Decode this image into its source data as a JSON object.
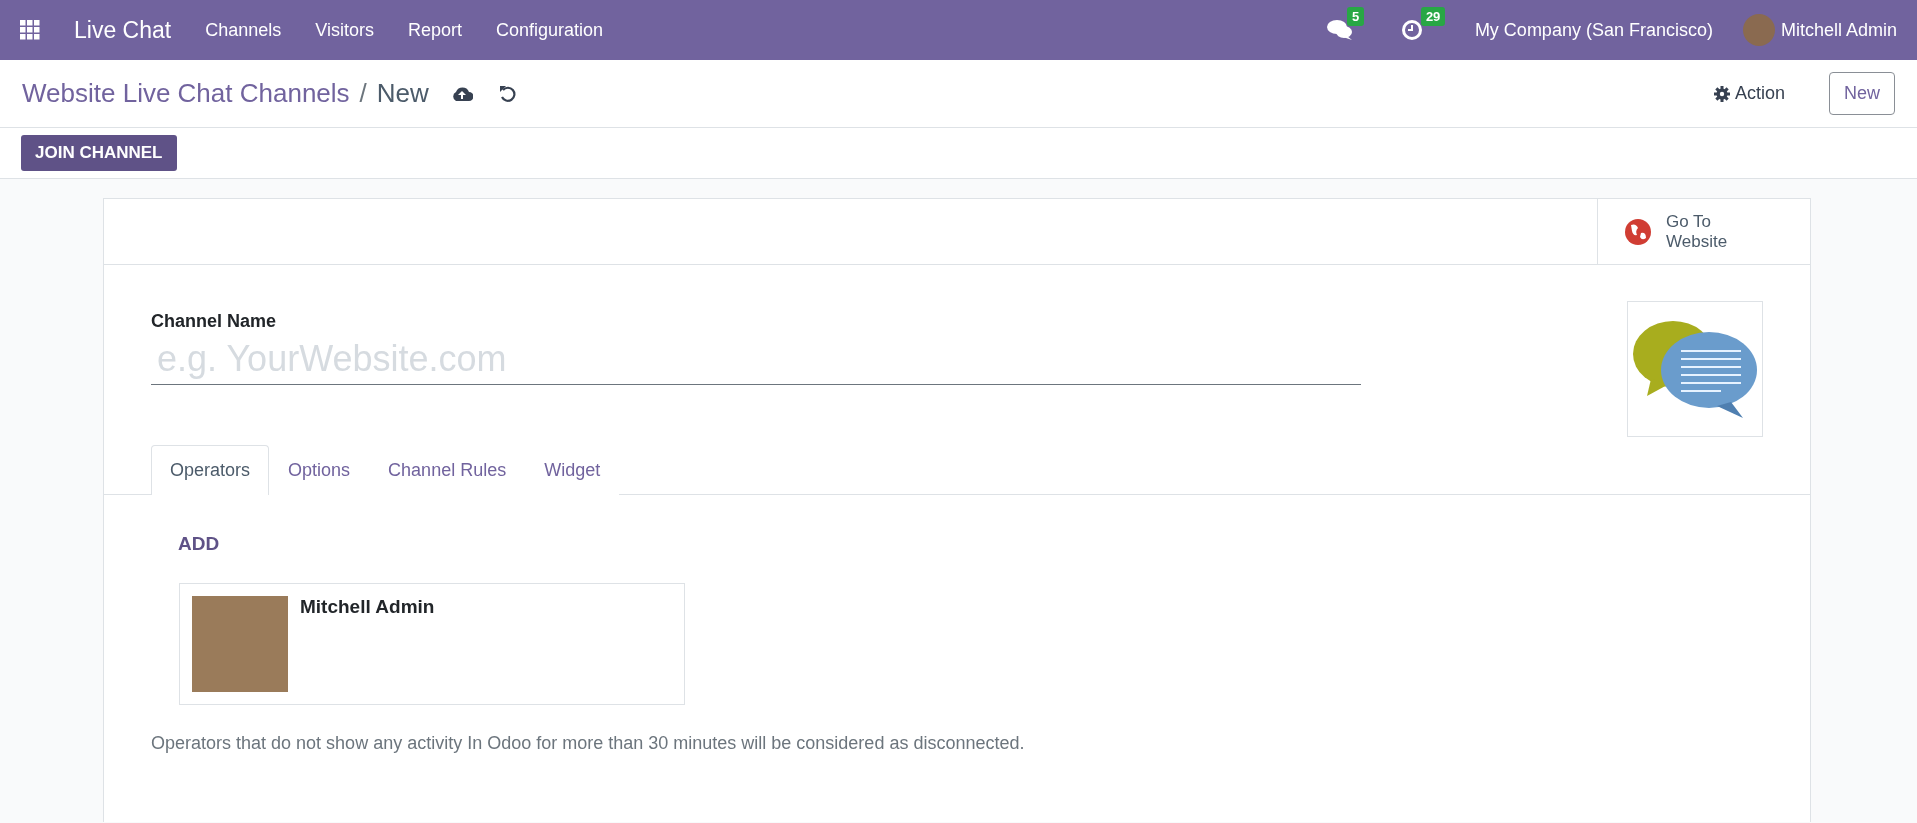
{
  "navbar": {
    "app_name": "Live Chat",
    "menu": [
      "Channels",
      "Visitors",
      "Report",
      "Configuration"
    ],
    "messages_count": "5",
    "activities_count": "29",
    "company": "My Company (San Francisco)",
    "user": "Mitchell Admin"
  },
  "control_panel": {
    "breadcrumb": "Website Live Chat Channels",
    "separator": "/",
    "current": "New",
    "action": "Action",
    "new_button": "New"
  },
  "status_bar": {
    "buttons": [
      "JOIN CHANNEL"
    ]
  },
  "form": {
    "smart_button": {
      "line_1": "Go To",
      "line_2": "Website"
    },
    "field_label": "Channel Name",
    "field_placeholder": "e.g. YourWebsite.com",
    "tabs": [
      {
        "label": "Operators",
        "selected": true
      },
      {
        "label": "Options",
        "selected": false
      },
      {
        "label": "Channel Rules",
        "selected": false
      },
      {
        "label": "Widget",
        "selected": false
      }
    ],
    "add_link": "ADD",
    "operators": [
      {
        "name": "Mitchell Admin"
      }
    ],
    "note": "Operators that do not show any activity In Odoo for more than 30 minutes will be considered as disconnected."
  }
}
